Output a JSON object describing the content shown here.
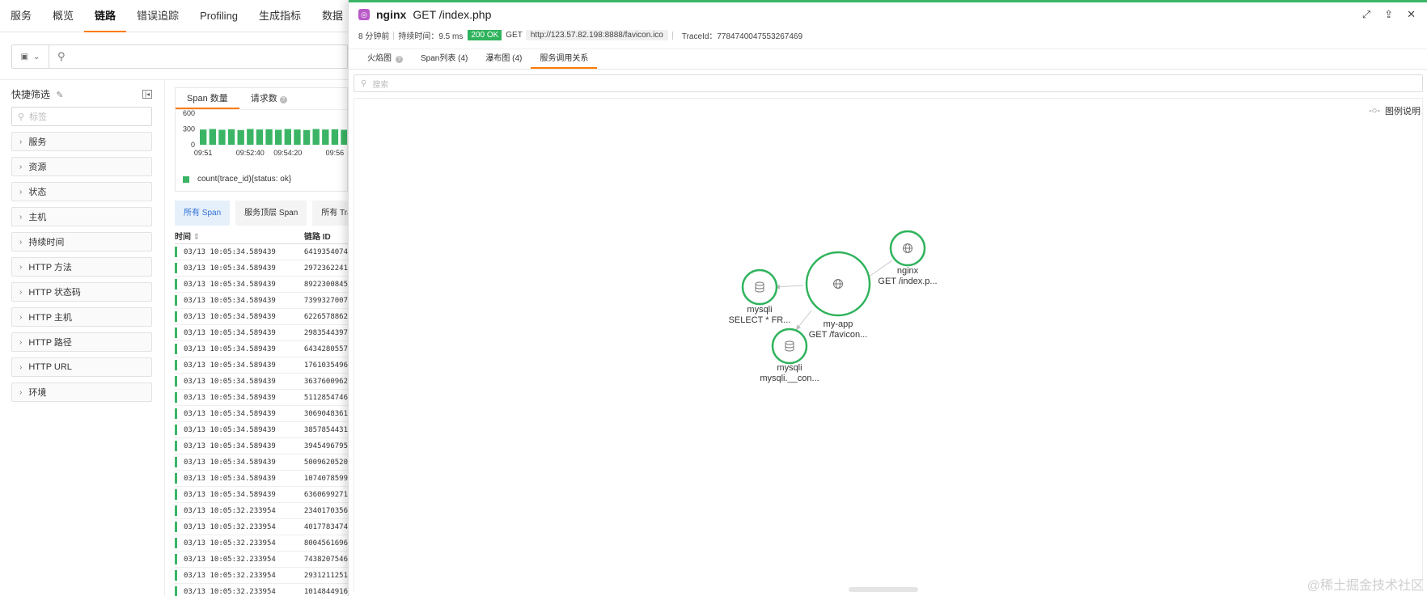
{
  "nav": {
    "items": [
      "服务",
      "概览",
      "链路",
      "错误追踪",
      "Profiling",
      "生成指标",
      "数据"
    ],
    "active_index": 2
  },
  "sidebar": {
    "title": "快捷筛选",
    "search_placeholder": "标签",
    "filters": [
      "服务",
      "资源",
      "状态",
      "主机",
      "持续时间",
      "HTTP 方法",
      "HTTP 状态码",
      "HTTP 主机",
      "HTTP 路径",
      "HTTP URL",
      "环境"
    ]
  },
  "chart": {
    "tabs": [
      "Span 数量",
      "请求数"
    ],
    "active_tab": 0,
    "legend_label": "count(trace_id){status: ok}",
    "color": "#3bb565"
  },
  "chart_data": {
    "type": "bar",
    "categories": [
      "09:51",
      "",
      "",
      "",
      "",
      "09:52:40",
      "",
      "",
      "",
      "09:54:20",
      "",
      "",
      "",
      "",
      "09:56",
      ""
    ],
    "values": [
      290,
      300,
      285,
      295,
      280,
      300,
      290,
      295,
      285,
      300,
      290,
      280,
      300,
      290,
      295,
      285
    ],
    "ylim": [
      0,
      600
    ],
    "yticks": [
      "600",
      "300",
      "0"
    ],
    "xticks": [
      "09:51",
      "09:52:40",
      "09:54:20",
      "09:56"
    ],
    "title": "",
    "xlabel": "",
    "ylabel": ""
  },
  "span_tabs": [
    "所有 Span",
    "服务顶层 Span",
    "所有 Trace"
  ],
  "table": {
    "headers": {
      "time": "时间",
      "trace_id": "链路 ID"
    },
    "rows": [
      {
        "time": "03/13 10:05:34.589439",
        "id": "6419354074"
      },
      {
        "time": "03/13 10:05:34.589439",
        "id": "2972362241"
      },
      {
        "time": "03/13 10:05:34.589439",
        "id": "8922300845"
      },
      {
        "time": "03/13 10:05:34.589439",
        "id": "7399327007"
      },
      {
        "time": "03/13 10:05:34.589439",
        "id": "6226578862"
      },
      {
        "time": "03/13 10:05:34.589439",
        "id": "2983544397"
      },
      {
        "time": "03/13 10:05:34.589439",
        "id": "6434280557"
      },
      {
        "time": "03/13 10:05:34.589439",
        "id": "1761035496"
      },
      {
        "time": "03/13 10:05:34.589439",
        "id": "3637600962"
      },
      {
        "time": "03/13 10:05:34.589439",
        "id": "5112854746"
      },
      {
        "time": "03/13 10:05:34.589439",
        "id": "3069048361"
      },
      {
        "time": "03/13 10:05:34.589439",
        "id": "3857854431"
      },
      {
        "time": "03/13 10:05:34.589439",
        "id": "3945496795"
      },
      {
        "time": "03/13 10:05:34.589439",
        "id": "5009620520"
      },
      {
        "time": "03/13 10:05:34.589439",
        "id": "1074078599"
      },
      {
        "time": "03/13 10:05:34.589439",
        "id": "6360699271"
      },
      {
        "time": "03/13 10:05:32.233954",
        "id": "2340170356"
      },
      {
        "time": "03/13 10:05:32.233954",
        "id": "4017783474"
      },
      {
        "time": "03/13 10:05:32.233954",
        "id": "8004561696"
      },
      {
        "time": "03/13 10:05:32.233954",
        "id": "7438207546"
      },
      {
        "time": "03/13 10:05:32.233954",
        "id": "2931211251"
      },
      {
        "time": "03/13 10:05:32.233954",
        "id": "1014844916"
      }
    ]
  },
  "drawer": {
    "service": "nginx",
    "resource": "GET /index.php",
    "time_ago": "8 分钟前",
    "duration": "持续时间：9.5 ms",
    "status": "200 OK",
    "method": "GET",
    "url": "http://123.57.82.198:8888/favicon.ico",
    "trace_id": "TraceId：7784740047553267469",
    "tabs": [
      "火焰图",
      "Span列表 (4)",
      "瀑布图 (4)",
      "服务调用关系"
    ],
    "active_tab": 3,
    "search_placeholder": "搜索",
    "legend_button": "图例说明",
    "graph_nodes": [
      {
        "name": "nginx",
        "resource": "GET /index.p...",
        "icon": "globe-icon"
      },
      {
        "name": "my-app",
        "resource": "GET /favicon...",
        "icon": "globe-icon"
      },
      {
        "name": "mysqli",
        "resource": "SELECT * FR...",
        "icon": "database-icon"
      },
      {
        "name": "mysqli",
        "resource": "mysqli.__con...",
        "icon": "database-icon"
      }
    ],
    "node_color": "#2fb35c"
  },
  "watermark": "@稀土掘金技术社区"
}
